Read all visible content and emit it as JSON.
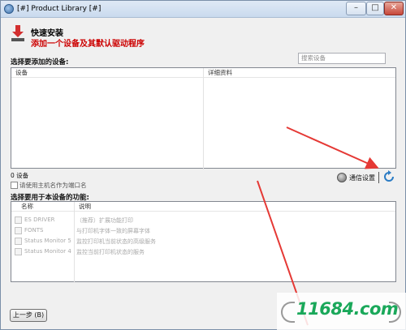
{
  "window": {
    "title": "[#] Product Library [#]"
  },
  "header": {
    "title": "快速安装",
    "subtitle": "添加一个设备及其默认驱动程序"
  },
  "devices": {
    "section_label": "选择要添加的设备:",
    "search_placeholder": "搜索设备",
    "columns": [
      "设备",
      "详细资料"
    ],
    "count_label": "0 设备",
    "hostname_checkbox_label": "请使用主机名作为端口名",
    "comm_settings_label": "通信设置"
  },
  "functions": {
    "section_label": "选择要用于本设备的功能:",
    "columns": [
      "名称",
      "说明"
    ],
    "rows": [
      {
        "name": "ES DRIVER",
        "desc": "（推荐）扩展功能打印"
      },
      {
        "name": "FONTS",
        "desc": "与打印机字体一致的屏幕字体"
      },
      {
        "name": "Status Monitor 5",
        "desc": "监控打印机当前状态的高级服务"
      },
      {
        "name": "Status Monitor 4",
        "desc": "监控当前打印机状态的服务"
      }
    ]
  },
  "footer": {
    "back_label": "上一步 (B)"
  },
  "watermark": {
    "text": "11684.com"
  },
  "colors": {
    "accent_red": "#cc0000",
    "arrow_red": "#e53935",
    "watermark_green": "#1aa85a"
  }
}
